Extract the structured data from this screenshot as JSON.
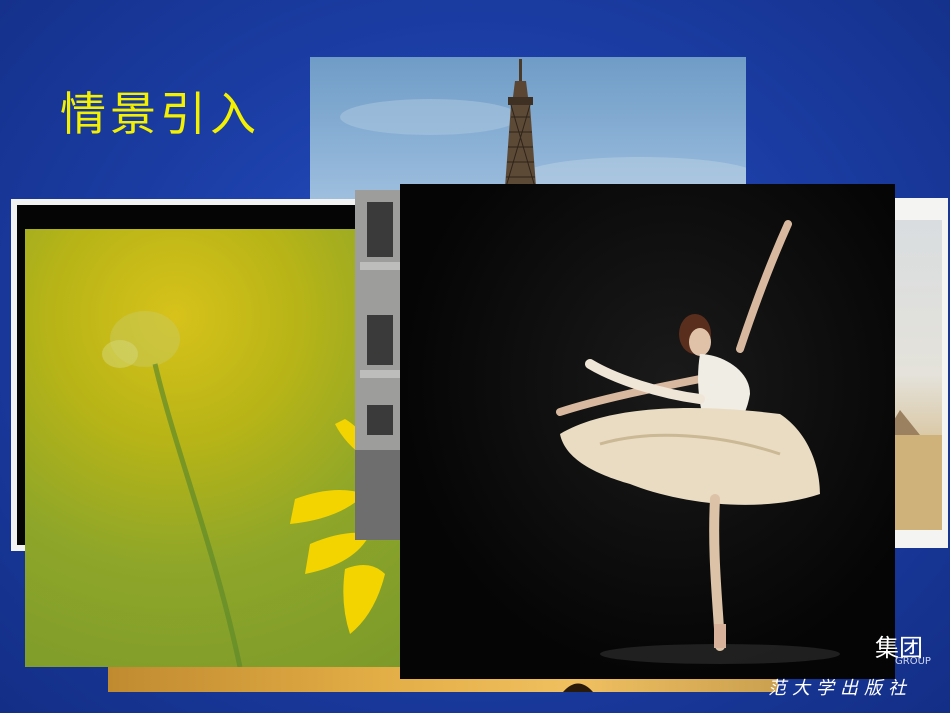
{
  "slide": {
    "title": "情景引入"
  },
  "footer": {
    "logo_text": "集团",
    "logo_sub": "GROUP",
    "press_text": "范大学出版社"
  },
  "photos": [
    {
      "name": "eiffel-tower-photo"
    },
    {
      "name": "desert-photo"
    },
    {
      "name": "flower-photo"
    },
    {
      "name": "building-photo"
    },
    {
      "name": "ballet-dancer-photo"
    }
  ]
}
